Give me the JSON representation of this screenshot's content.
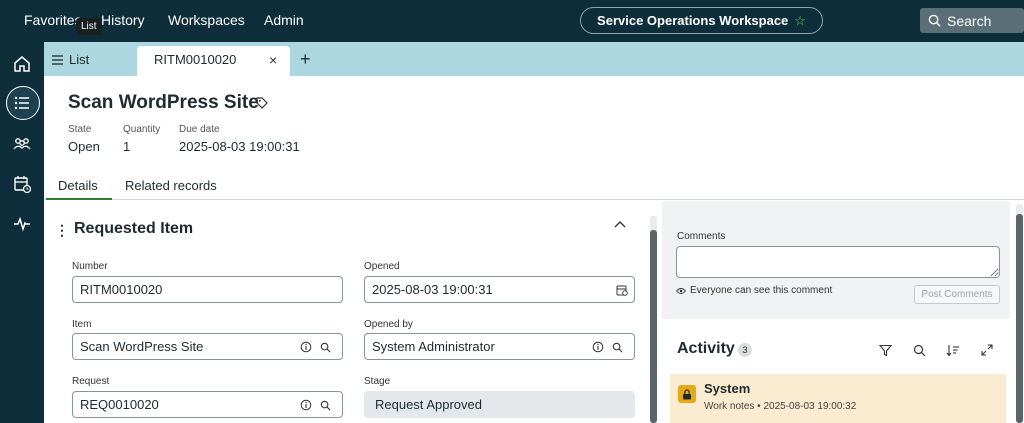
{
  "topnav": {
    "items": [
      "Favorites",
      "History",
      "Workspaces",
      "Admin"
    ],
    "tooltip": "List",
    "workspace": "Service Operations Workspace",
    "search": "Search"
  },
  "tabs": {
    "list_label": "List",
    "active_tab": "RITM0010020",
    "close": "×",
    "add": "+"
  },
  "record": {
    "title": "Scan WordPress Site",
    "meta": [
      {
        "label": "State",
        "value": "Open"
      },
      {
        "label": "Quantity",
        "value": "1"
      },
      {
        "label": "Due date",
        "value": "2025-08-03 19:00:31"
      }
    ]
  },
  "subtabs": [
    "Details",
    "Related records"
  ],
  "form": {
    "section_title": "Requested Item",
    "fields": {
      "number": {
        "label": "Number",
        "value": "RITM0010020"
      },
      "opened": {
        "label": "Opened",
        "value": "2025-08-03 19:00:31"
      },
      "item": {
        "label": "Item",
        "value": "Scan WordPress Site"
      },
      "opened_by": {
        "label": "Opened by",
        "value": "System Administrator"
      },
      "request": {
        "label": "Request",
        "value": "REQ0010020"
      },
      "stage": {
        "label": "Stage",
        "value": "Request Approved"
      }
    }
  },
  "activity_panel": {
    "comments_label": "Comments",
    "visibility_note": "Everyone can see this comment",
    "post_button": "Post Comments",
    "activity_title": "Activity",
    "activity_count": "3",
    "entry": {
      "author": "System",
      "meta": "Work notes • 2025-08-03 19:00:32"
    }
  },
  "colors": {
    "topbar": "#0e2e3b",
    "tabstrip": "#acd6e0",
    "accent_green": "#2e7d32",
    "activity_card": "#fbecd1",
    "lock_badge": "#e6a817"
  }
}
